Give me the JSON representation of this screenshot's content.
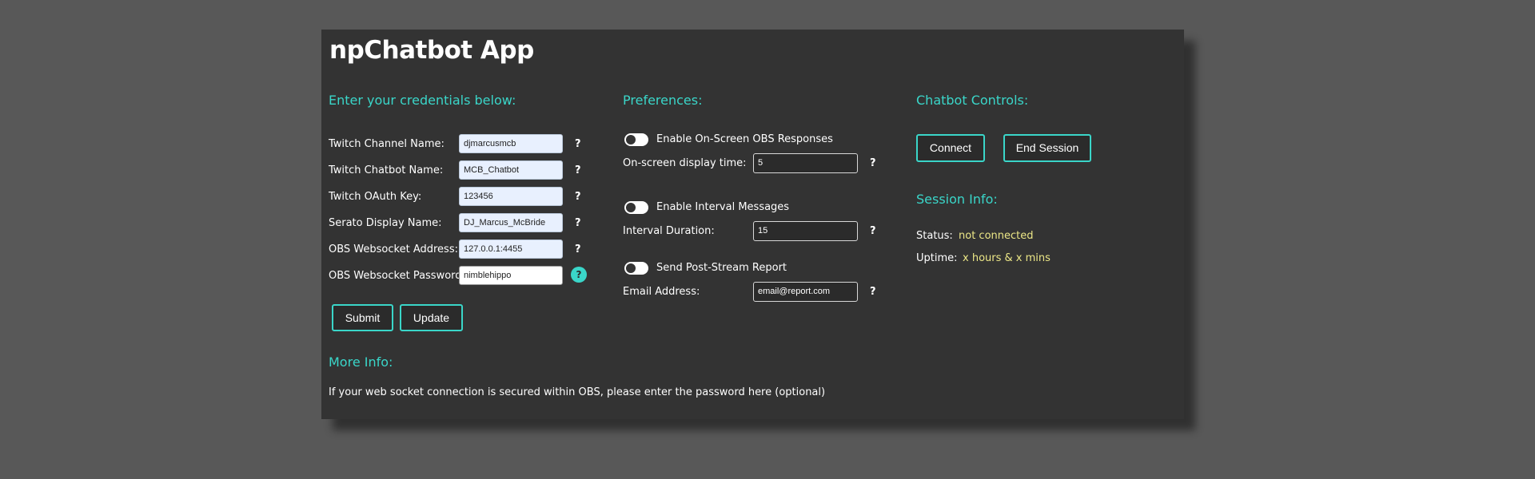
{
  "app": {
    "title": "npChatbot App"
  },
  "credentials": {
    "heading": "Enter your credentials below:",
    "fields": [
      {
        "label": "Twitch Channel Name:",
        "value": "djmarcusmcb"
      },
      {
        "label": "Twitch Chatbot Name:",
        "value": "MCB_Chatbot"
      },
      {
        "label": "Twitch OAuth Key:",
        "value": "123456"
      },
      {
        "label": "Serato Display Name:",
        "value": "DJ_Marcus_McBride"
      },
      {
        "label": "OBS Websocket Address:",
        "value": "127.0.0.1:4455"
      },
      {
        "label": "OBS Websocket Password:",
        "value": "nimblehippo"
      }
    ],
    "help_glyph": "?",
    "submit_label": "Submit",
    "update_label": "Update"
  },
  "more_info": {
    "heading": "More Info:",
    "text": "If your web socket connection is secured within OBS, please enter the password here (optional)"
  },
  "preferences": {
    "heading": "Preferences:",
    "obs_toggle_label": "Enable On-Screen OBS Responses",
    "display_time_label": "On-screen display time:",
    "display_time_value": "5",
    "interval_toggle_label": "Enable Interval Messages",
    "interval_duration_label": "Interval Duration:",
    "interval_duration_value": "15",
    "report_toggle_label": "Send Post-Stream Report",
    "email_label": "Email Address:",
    "email_value": "email@report.com",
    "help_glyph": "?"
  },
  "controls": {
    "heading": "Chatbot Controls:",
    "connect_label": "Connect",
    "end_session_label": "End Session"
  },
  "session": {
    "heading": "Session Info:",
    "status_label": "Status:",
    "status_value": "not connected",
    "uptime_label": "Uptime:",
    "uptime_value": "x hours & x mins"
  },
  "colors": {
    "background": "#585858",
    "panel": "#333333",
    "accent": "#3ad6c9",
    "status_value": "#ece787"
  }
}
